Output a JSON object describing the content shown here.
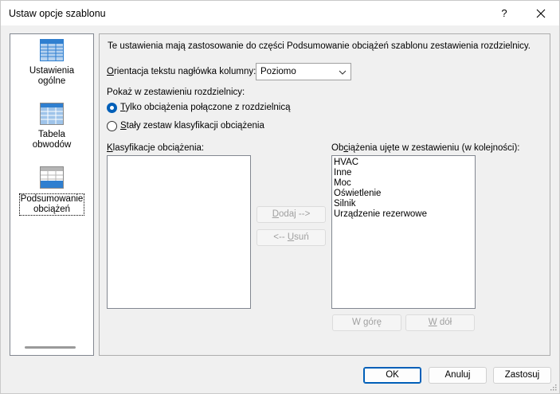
{
  "window": {
    "title": "Ustaw opcje szablonu",
    "help_label": "?",
    "close_icon": "close-icon"
  },
  "nav": {
    "items": [
      {
        "line1": "Ustawienia",
        "line2": "ogólne",
        "icon": "table-grid-icon",
        "selected": false
      },
      {
        "line1": "Tabela",
        "line2": "obwodów",
        "icon": "table-grid-icon",
        "selected": false
      },
      {
        "line1": "Podsumowanie",
        "line2": "obciążeń",
        "icon": "table-grid-icon",
        "selected": true
      }
    ]
  },
  "panel": {
    "description": "Te ustawienia mają zastosowanie do części Podsumowanie obciążeń szablonu zestawienia rozdzielnicy.",
    "orientation": {
      "label_mnemonic": "O",
      "label_rest": "rientacja tekstu nagłówka kolumny:",
      "value": "Poziomo"
    },
    "show_label": "Pokaż w zestawieniu rozdzielnicy:",
    "radio1": {
      "mnemonic": "T",
      "rest": "ylko obciążenia połączone z rozdzielnicą",
      "checked": true
    },
    "radio2": {
      "mnemonic": "S",
      "rest": "tały zestaw klasyfikacji obciążenia",
      "checked": false
    },
    "left_list": {
      "label_mnemonic": "K",
      "label_rest": "lasyfikacje obciążenia:",
      "items": []
    },
    "right_list": {
      "label_pre": "Ob",
      "label_mnemonic": "c",
      "label_rest": "iążenia ujęte w zestawieniu (w kolejności):",
      "items": [
        "HVAC",
        "Inne",
        "Moc",
        "Oświetlenie",
        "Silnik",
        "Urządzenie rezerwowe"
      ]
    },
    "add_btn": {
      "mnemonic": "D",
      "rest": "odaj -->"
    },
    "remove_btn": {
      "pre": "<-- ",
      "mnemonic": "U",
      "rest": "suń"
    },
    "up_btn": {
      "pre": "W ",
      "mnemonic": "g",
      "rest": "órę"
    },
    "down_btn": {
      "mnemonic": "W",
      "rest": " dół"
    }
  },
  "footer": {
    "ok": "OK",
    "cancel": "Anuluj",
    "apply_pre": "Zastosu",
    "apply_mnemonic": "j"
  },
  "colors": {
    "accent": "#005fb8",
    "icon_blue": "#2f7fd0",
    "icon_gray": "#8a8a8a"
  }
}
